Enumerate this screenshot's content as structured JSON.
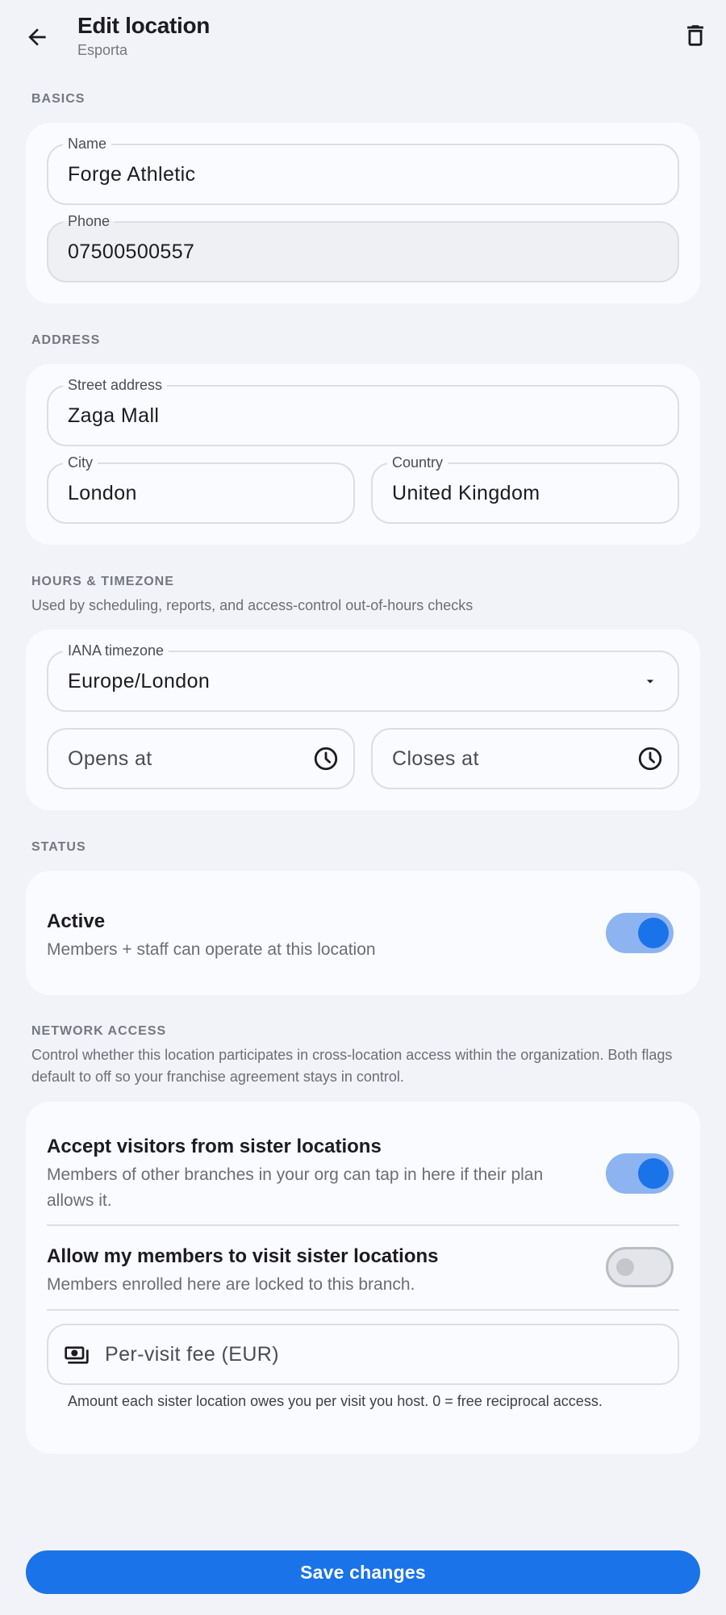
{
  "header": {
    "title": "Edit location",
    "subtitle": "Esporta"
  },
  "basics": {
    "label": "BASICS",
    "name": {
      "label": "Name",
      "value": "Forge Athletic"
    },
    "phone": {
      "label": "Phone",
      "value": "07500500557"
    }
  },
  "address": {
    "label": "ADDRESS",
    "street": {
      "label": "Street address",
      "value": "Zaga Mall"
    },
    "city": {
      "label": "City",
      "value": "London"
    },
    "country": {
      "label": "Country",
      "value": "United Kingdom"
    }
  },
  "hours": {
    "label": "HOURS & TIMEZONE",
    "description": "Used by scheduling, reports, and access-control out-of-hours checks",
    "timezone": {
      "label": "IANA timezone",
      "value": "Europe/London"
    },
    "opens": {
      "placeholder": "Opens at"
    },
    "closes": {
      "placeholder": "Closes at"
    }
  },
  "status": {
    "label": "STATUS",
    "active": {
      "title": "Active",
      "description": "Members + staff can operate at this location",
      "on": true
    }
  },
  "network": {
    "label": "NETWORK ACCESS",
    "description": "Control whether this location participates in cross-location access within the organization. Both flags default to off so your franchise agreement stays in control.",
    "accept_visitors": {
      "title": "Accept visitors from sister locations",
      "description": "Members of other branches in your org can tap in here if their plan allows it.",
      "on": true
    },
    "allow_members": {
      "title": "Allow my members to visit sister locations",
      "description": "Members enrolled here are locked to this branch.",
      "on": false
    },
    "fee": {
      "placeholder": "Per-visit fee (EUR)",
      "helper": "Amount each sister location owes you per visit you host. 0 = free reciprocal access."
    }
  },
  "actions": {
    "save_label": "Save changes"
  },
  "colors": {
    "primary": "#1a73e8",
    "toggle_track_on": "#8db4f0",
    "background": "#f2f3f8"
  }
}
